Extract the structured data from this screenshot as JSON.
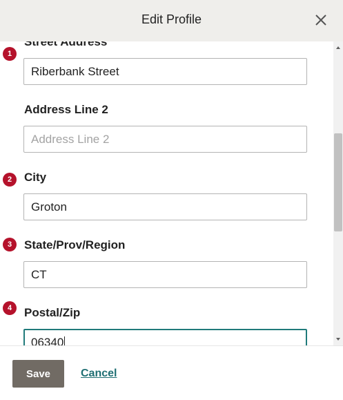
{
  "dialog": {
    "title": "Edit Profile",
    "close_icon": "close-icon"
  },
  "fields": [
    {
      "label": "Street Address",
      "value": "Riberbank Street",
      "placeholder": "",
      "step": "1"
    },
    {
      "label": "Address Line 2",
      "value": "",
      "placeholder": "Address Line 2",
      "step": ""
    },
    {
      "label": "City",
      "value": "Groton",
      "placeholder": "",
      "step": "2"
    },
    {
      "label": "State/Prov/Region",
      "value": "CT",
      "placeholder": "",
      "step": "3"
    },
    {
      "label": "Postal/Zip",
      "value": "06340",
      "placeholder": "",
      "step": "4"
    }
  ],
  "footer": {
    "save_label": "Save",
    "cancel_label": "Cancel"
  },
  "colors": {
    "header_bg": "#efeeeb",
    "badge": "#b5122b",
    "save_bg": "#716b64",
    "link": "#1f6f73",
    "focus_border": "#1f7a7a"
  }
}
